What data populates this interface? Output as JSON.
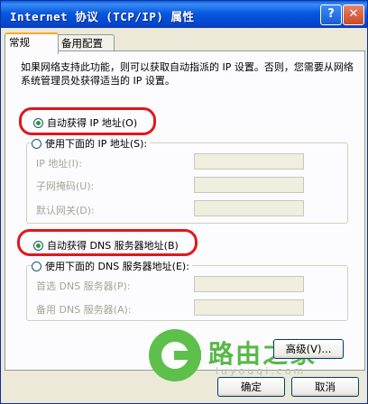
{
  "window": {
    "title": "Internet 协议 (TCP/IP) 属性",
    "help_glyph": "?",
    "close_glyph": "✕"
  },
  "tabs": [
    {
      "label": "常规"
    },
    {
      "label": "备用配置"
    }
  ],
  "description": "如果网络支持此功能，则可以获取自动指派的 IP 设置。否则，您需要从网络系统管理员处获得适当的 IP 设置。",
  "ip_section": {
    "auto_label": "自动获得 IP 地址(O)",
    "manual_label": "使用下面的 IP 地址(S):",
    "fields": [
      {
        "label": "IP 地址(I):",
        "value": ""
      },
      {
        "label": "子网掩码(U):",
        "value": ""
      },
      {
        "label": "默认网关(D):",
        "value": ""
      }
    ]
  },
  "dns_section": {
    "auto_label": "自动获得 DNS 服务器地址(B)",
    "manual_label": "使用下面的 DNS 服务器地址(E):",
    "fields": [
      {
        "label": "首选 DNS 服务器(P):",
        "value": ""
      },
      {
        "label": "备用 DNS 服务器(A):",
        "value": ""
      }
    ]
  },
  "buttons": {
    "advanced": "高级(V)...",
    "ok": "确定",
    "cancel": "取消"
  },
  "watermark": {
    "text": "路由之家",
    "url": "luyouqi.com"
  }
}
